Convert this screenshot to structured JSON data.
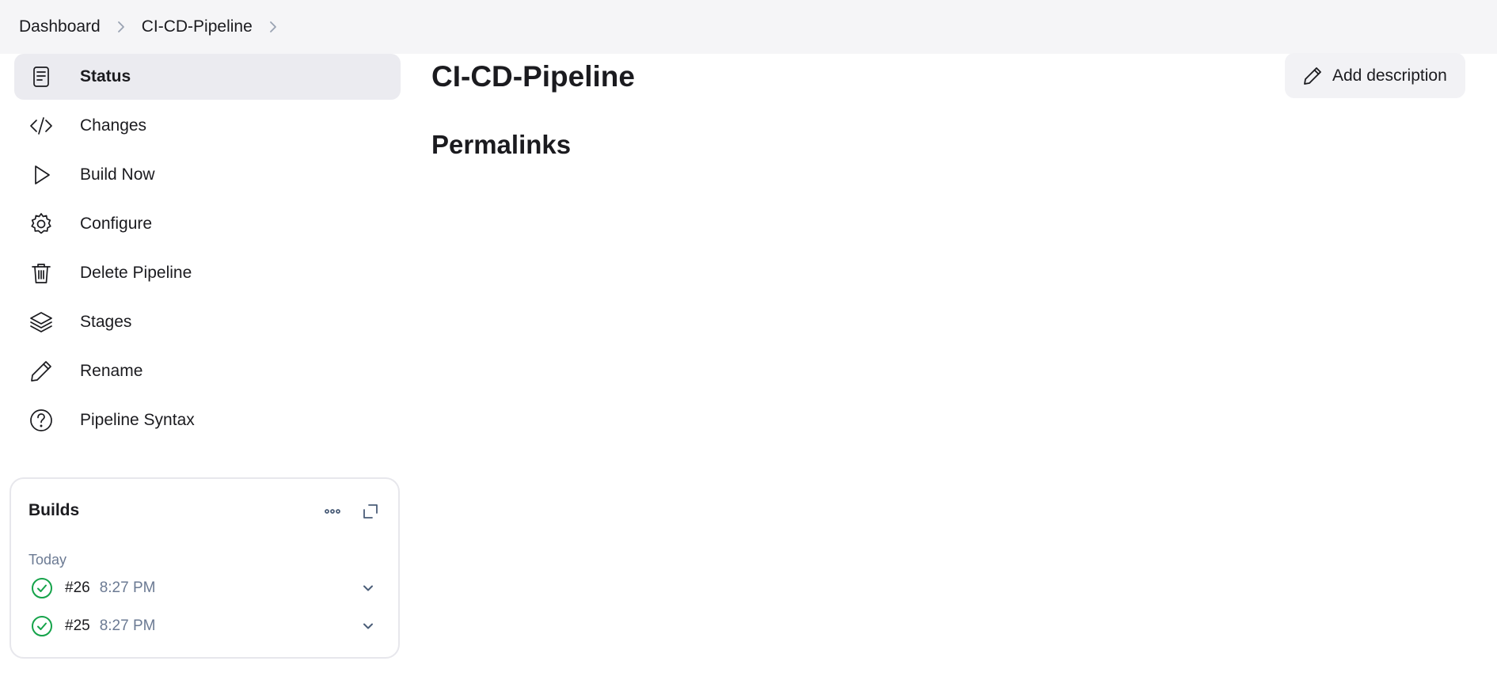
{
  "breadcrumb": {
    "items": [
      {
        "label": "Dashboard"
      },
      {
        "label": "CI-CD-Pipeline"
      }
    ]
  },
  "sidebar": {
    "items": [
      {
        "label": "Status",
        "icon": "status-icon",
        "active": true
      },
      {
        "label": "Changes",
        "icon": "code-icon"
      },
      {
        "label": "Build Now",
        "icon": "play-icon"
      },
      {
        "label": "Configure",
        "icon": "gear-icon"
      },
      {
        "label": "Delete Pipeline",
        "icon": "trash-icon"
      },
      {
        "label": "Stages",
        "icon": "layers-icon"
      },
      {
        "label": "Rename",
        "icon": "pencil-icon"
      },
      {
        "label": "Pipeline Syntax",
        "icon": "help-icon"
      }
    ]
  },
  "builds": {
    "title": "Builds",
    "day": "Today",
    "items": [
      {
        "number": "#26",
        "time": "8:27 PM",
        "status": "success"
      },
      {
        "number": "#25",
        "time": "8:27 PM",
        "status": "success"
      }
    ]
  },
  "main": {
    "title": "CI-CD-Pipeline",
    "add_description": "Add description",
    "permalinks_title": "Permalinks"
  },
  "colors": {
    "success": "#15a34a",
    "active_bg": "#ebebf0",
    "topbar_bg": "#f5f5f7",
    "muted_text": "#6b7a93"
  }
}
